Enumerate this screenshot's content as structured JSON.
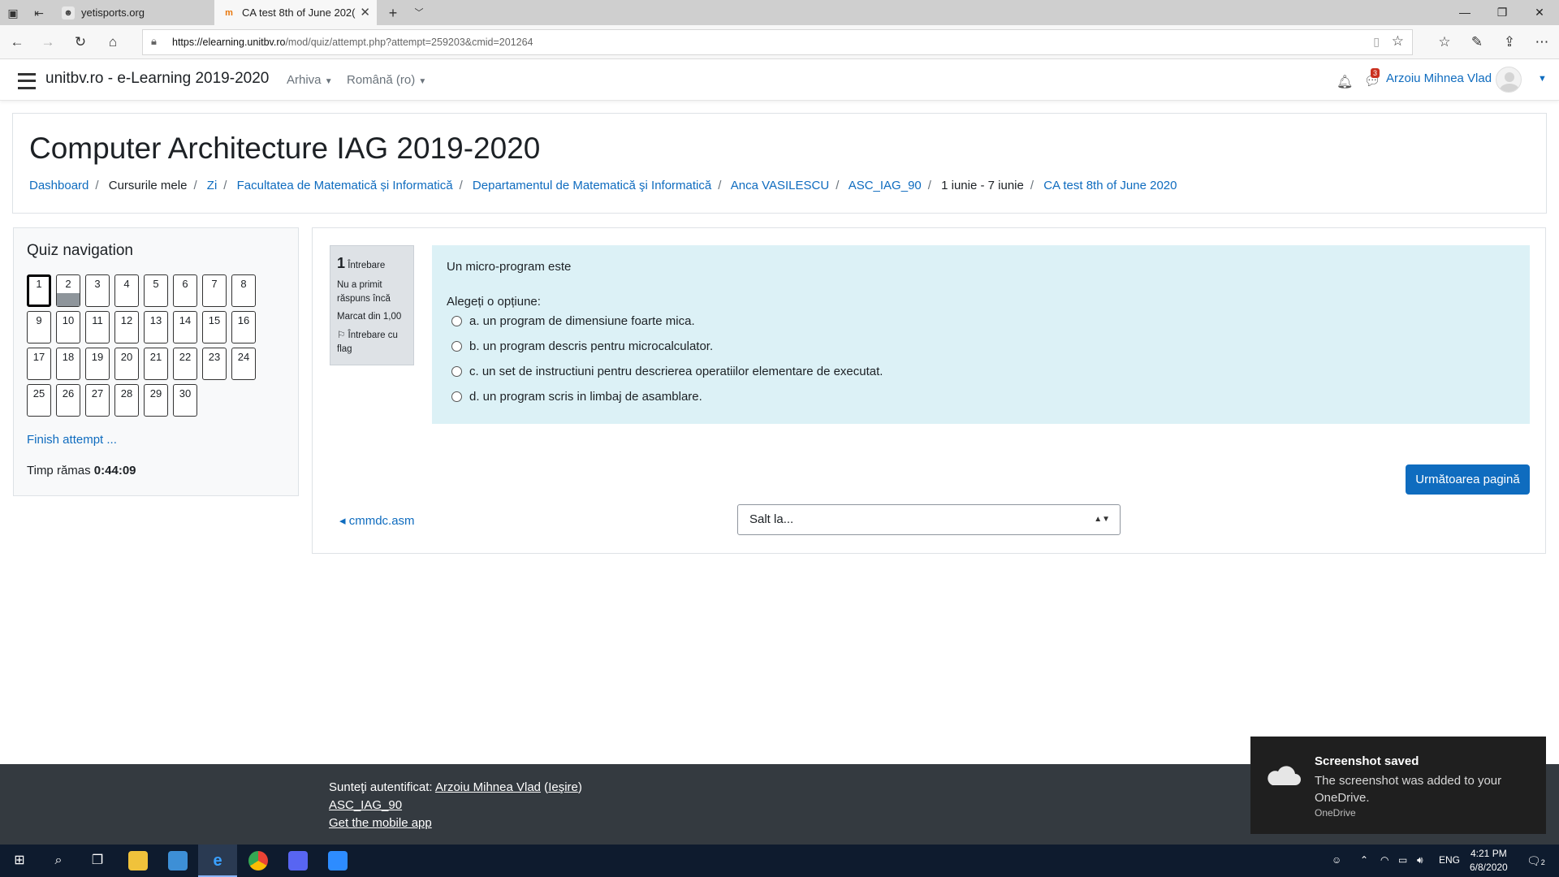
{
  "browser": {
    "tabs": [
      {
        "title": "yetisports.org",
        "active": false
      },
      {
        "title": "CA test 8th of June 202(",
        "active": true
      }
    ],
    "url_domain": "https://elearning.unitbv.ro",
    "url_path": "/mod/quiz/attempt.php?attempt=259203&cmid=201264"
  },
  "navbar": {
    "site_name": "unitbv.ro - e-Learning 2019-2020",
    "archive_menu": "Arhiva",
    "language_menu": "Română (ro)",
    "message_count": "3",
    "user_name": "Arzoiu Mihnea Vlad"
  },
  "header": {
    "course_title": "Computer Architecture IAG 2019-2020",
    "breadcrumb": [
      {
        "label": "Dashboard",
        "link": true
      },
      {
        "label": "Cursurile mele",
        "link": false
      },
      {
        "label": "Zi",
        "link": true
      },
      {
        "label": "Facultatea de Matematică și Informatică",
        "link": true
      },
      {
        "label": "Departamentul de Matematică şi Informatică",
        "link": true
      },
      {
        "label": "Anca VASILESCU",
        "link": true
      },
      {
        "label": "ASC_IAG_90",
        "link": true
      },
      {
        "label": "1 iunie - 7 iunie",
        "link": false
      },
      {
        "label": "CA test 8th of June 2020",
        "link": true
      }
    ]
  },
  "quiz_nav": {
    "title": "Quiz navigation",
    "questions": [
      "1",
      "2",
      "3",
      "4",
      "5",
      "6",
      "7",
      "8",
      "9",
      "10",
      "11",
      "12",
      "13",
      "14",
      "15",
      "16",
      "17",
      "18",
      "19",
      "20",
      "21",
      "22",
      "23",
      "24",
      "25",
      "26",
      "27",
      "28",
      "29",
      "30"
    ],
    "current": "1",
    "answered_fill": [
      "2"
    ],
    "finish_label": "Finish attempt ...",
    "time_label": "Timp rămas",
    "time_value": "0:44:09"
  },
  "question": {
    "number": "1",
    "word": "Întrebare",
    "status": "Nu a primit răspuns încă",
    "mark": "Marcat din 1,00",
    "flag": "Întrebare cu flag",
    "text": "Un micro-program este",
    "prompt": "Alegeți o opțiune:",
    "options": [
      "a. un program de dimensiune foarte mica.",
      "b. un program descris pentru microcalculator.",
      "c. un set de instructiuni pentru descrierea operatiilor elementare de executat.",
      "d. un program scris in limbaj de asamblare."
    ]
  },
  "actions": {
    "next_page": "Următoarea pagină",
    "prev_activity": "cmmdc.asm",
    "jump_placeholder": "Salt la..."
  },
  "footer": {
    "logged_in_prefix": "Sunteţi autentificat:",
    "user": "Arzoiu Mihnea Vlad",
    "logout": "Ieşire",
    "course_link": "ASC_IAG_90",
    "mobile_app": "Get the mobile app"
  },
  "toast": {
    "title": "Screenshot saved",
    "body": "The screenshot was added to your OneDrive.",
    "source": "OneDrive"
  },
  "taskbar": {
    "language": "ENG",
    "time": "4:21 PM",
    "date": "6/8/2020",
    "notifications": "2"
  },
  "colors": {
    "link": "#0f6cbf",
    "question_bg": "#dcf1f6",
    "footer_bg": "#343a40",
    "taskbar_bg": "#0e1b2e"
  }
}
